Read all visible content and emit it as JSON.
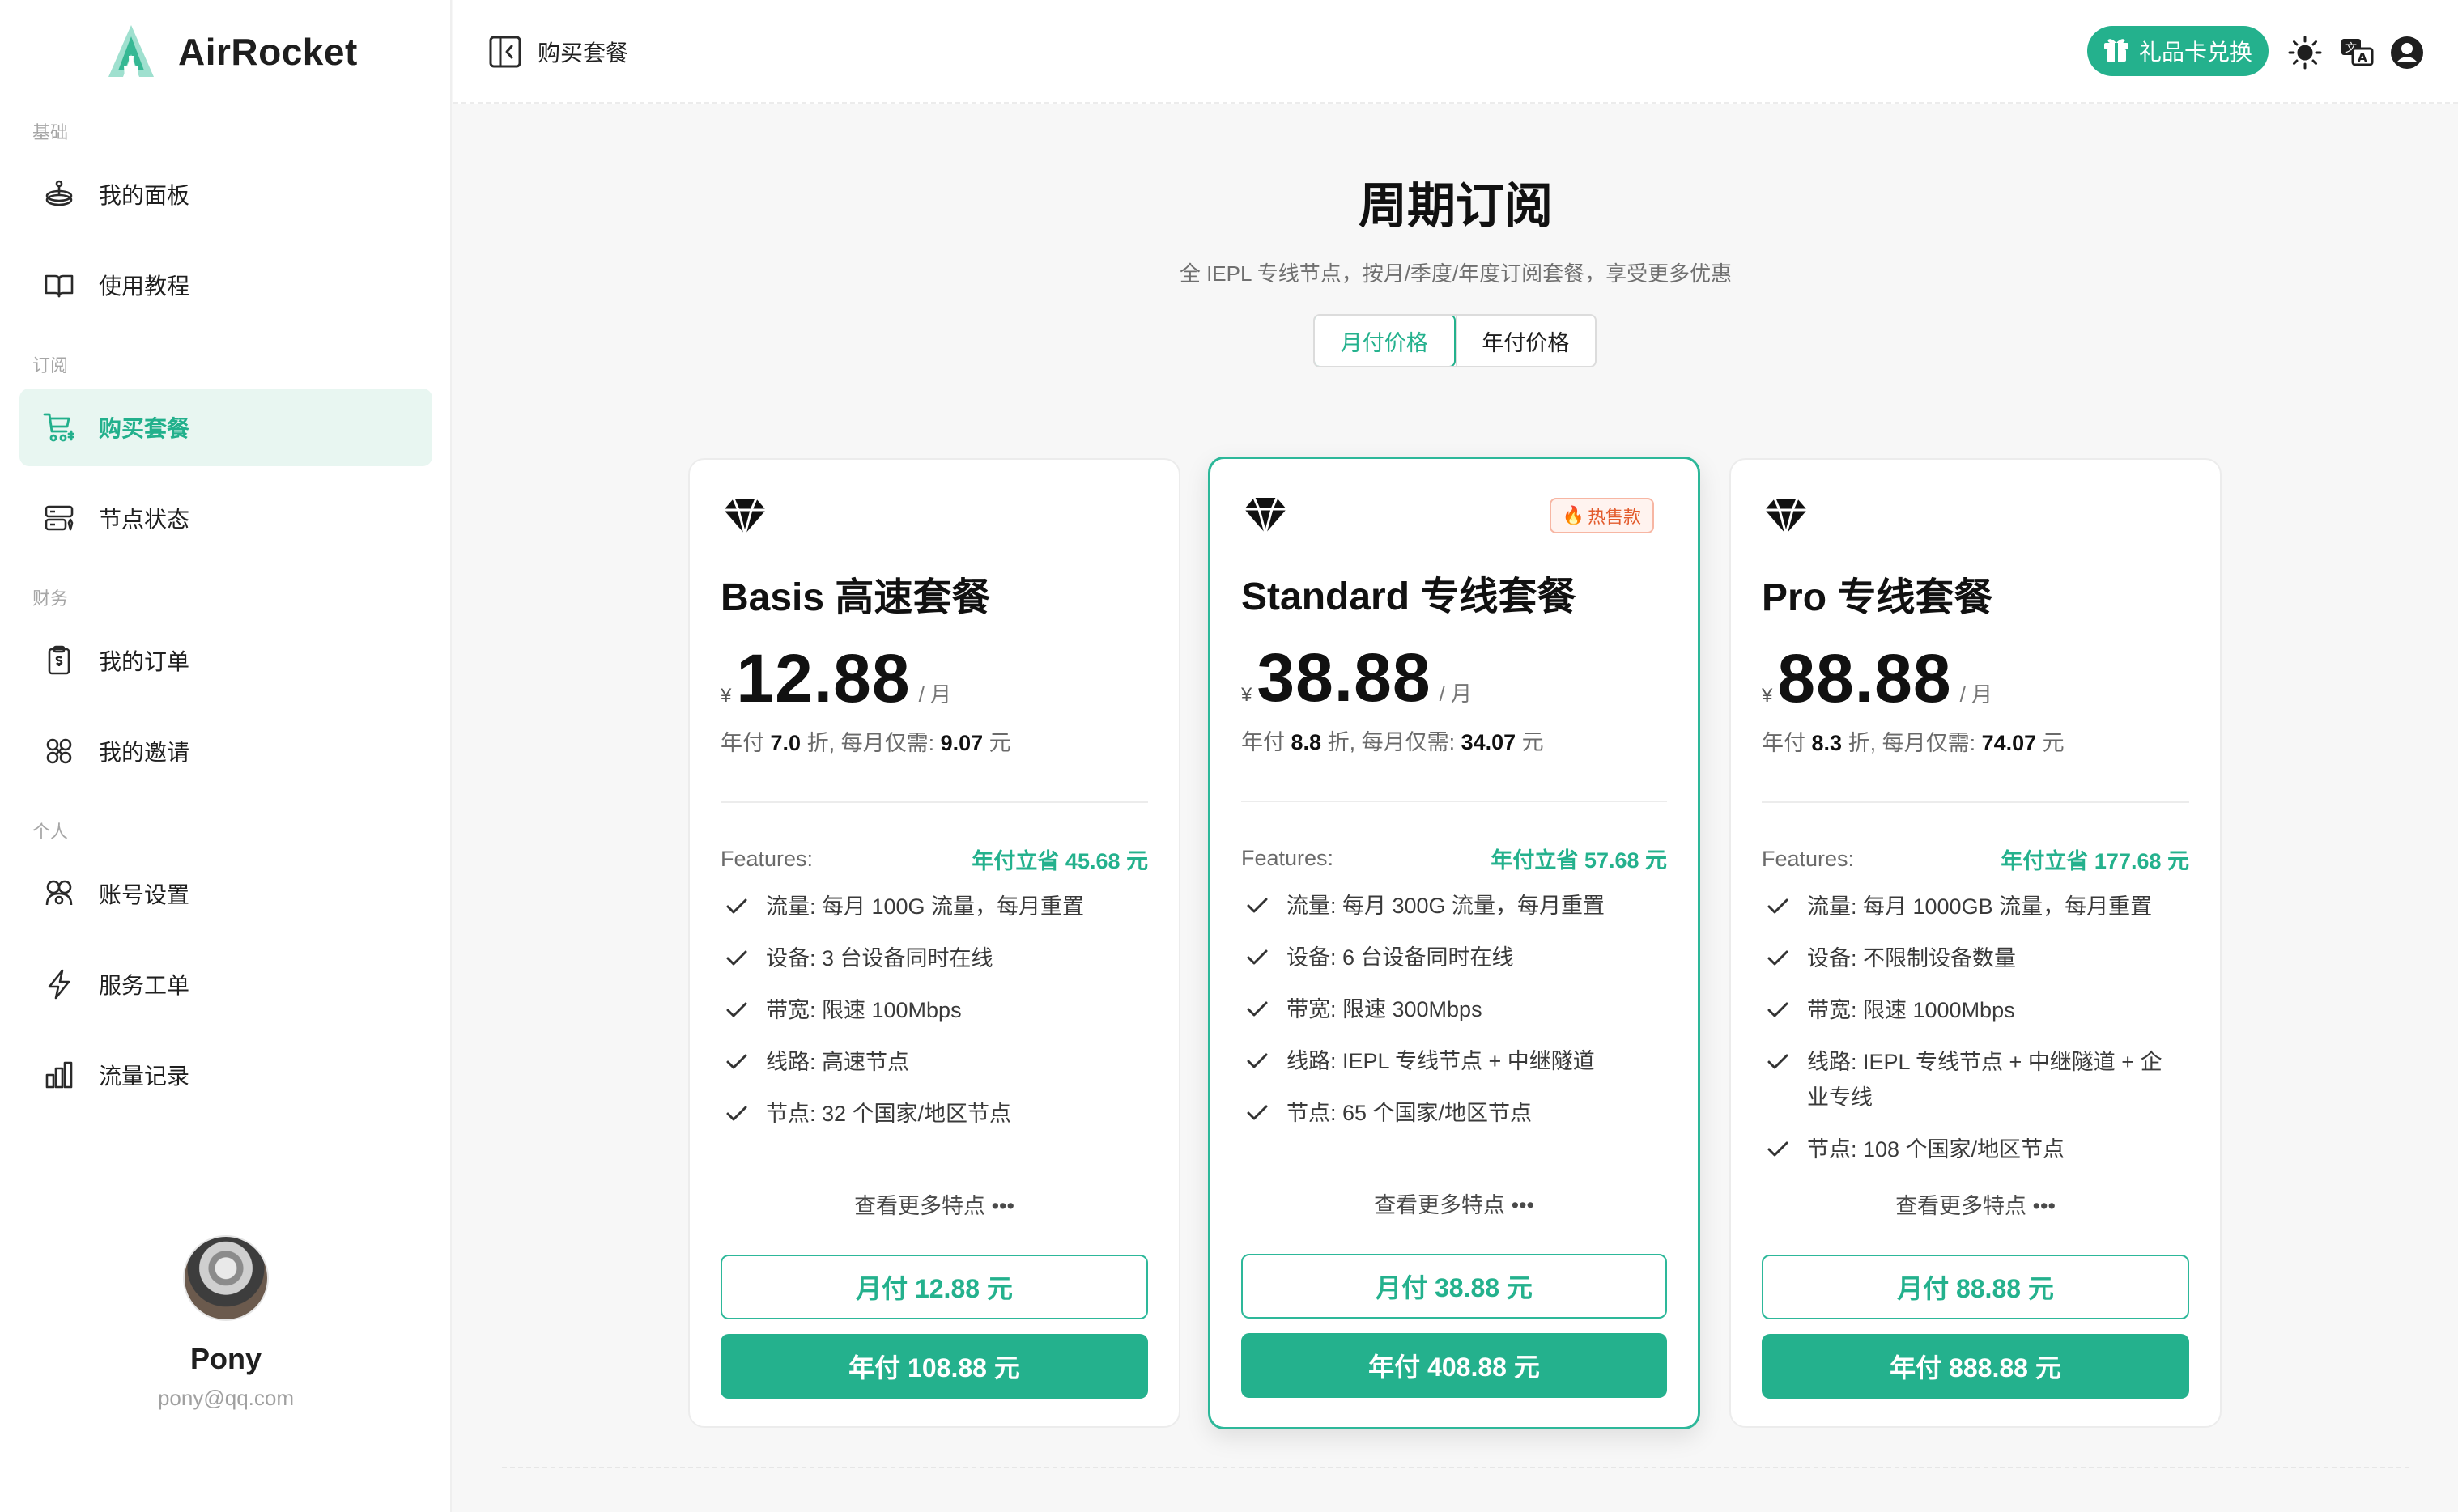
{
  "app": {
    "name": "AirRocket",
    "accent": "#24b18d"
  },
  "sidebar": {
    "sections": [
      "基础",
      "订阅",
      "财务",
      "个人"
    ],
    "items": [
      {
        "label": "我的面板",
        "icon": "dashboard-icon"
      },
      {
        "label": "使用教程",
        "icon": "book-icon"
      },
      {
        "label": "购买套餐",
        "icon": "cart-icon",
        "active": true
      },
      {
        "label": "节点状态",
        "icon": "server-icon"
      },
      {
        "label": "我的订单",
        "icon": "order-icon"
      },
      {
        "label": "我的邀请",
        "icon": "invite-icon"
      },
      {
        "label": "账号设置",
        "icon": "account-icon"
      },
      {
        "label": "服务工单",
        "icon": "bolt-icon"
      },
      {
        "label": "流量记录",
        "icon": "chart-icon"
      }
    ],
    "user": {
      "name": "Pony",
      "email": "pony@qq.com"
    }
  },
  "topbar": {
    "title": "购买套餐",
    "gift_label": "礼品卡兑换"
  },
  "main": {
    "title": "周期订阅",
    "subtitle": "全 IEPL 专线节点，按月/季度/年度订阅套餐，享受更多优惠",
    "toggle": {
      "monthly": "月付价格",
      "yearly": "年付价格",
      "selected": "monthly"
    },
    "currency": "¥",
    "per": "/ 月",
    "features_label": "Features:",
    "more_label": "查看更多特点 •••",
    "plans": [
      {
        "name": "Basis 高速套餐",
        "price": "12.88",
        "note_prefix": "年付 ",
        "discount": "7.0",
        "note_mid": " 折, 每月仅需: ",
        "monthly_equiv": "9.07",
        "note_suffix": " 元",
        "save": "年付立省 45.68 元",
        "features": [
          "流量: 每月 100G 流量，每月重置",
          "设备: 3 台设备同时在线",
          "带宽: 限速 100Mbps",
          "线路: 高速节点",
          "节点: 32 个国家/地区节点"
        ],
        "btn_monthly": "月付 12.88 元",
        "btn_yearly": "年付 108.88 元"
      },
      {
        "name": "Standard 专线套餐",
        "badge": "热售款",
        "price": "38.88",
        "note_prefix": "年付 ",
        "discount": "8.8",
        "note_mid": " 折, 每月仅需: ",
        "monthly_equiv": "34.07",
        "note_suffix": " 元",
        "save": "年付立省 57.68 元",
        "features": [
          "流量: 每月 300G 流量，每月重置",
          "设备: 6 台设备同时在线",
          "带宽: 限速 300Mbps",
          "线路: IEPL 专线节点 + 中继隧道",
          "节点: 65 个国家/地区节点"
        ],
        "btn_monthly": "月付 38.88 元",
        "btn_yearly": "年付 408.88 元"
      },
      {
        "name": "Pro 专线套餐",
        "price": "88.88",
        "note_prefix": "年付 ",
        "discount": "8.3",
        "note_mid": " 折, 每月仅需: ",
        "monthly_equiv": "74.07",
        "note_suffix": " 元",
        "save": "年付立省 177.68 元",
        "features": [
          "流量: 每月 1000GB 流量，每月重置",
          "设备: 不限制设备数量",
          "带宽: 限速 1000Mbps",
          "线路: IEPL 专线节点 + 中继隧道 + 企业专线",
          "节点: 108 个国家/地区节点"
        ],
        "btn_monthly": "月付 88.88 元",
        "btn_yearly": "年付 888.88 元"
      }
    ]
  }
}
